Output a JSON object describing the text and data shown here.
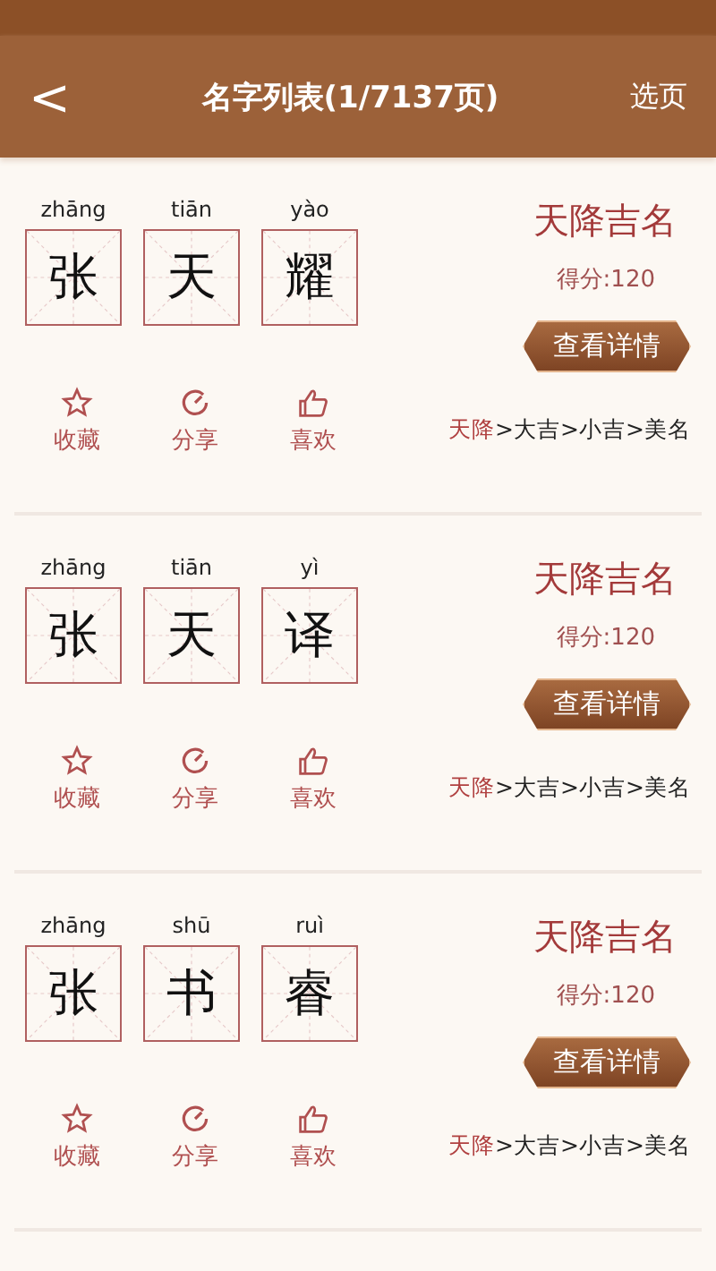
{
  "header": {
    "back": "<",
    "title": "名字列表(1/7137页)",
    "action": "选页"
  },
  "names": [
    {
      "chars": [
        {
          "pinyin": "zhāng",
          "char": "张"
        },
        {
          "pinyin": "tiān",
          "char": "天"
        },
        {
          "pinyin": "yào",
          "char": "耀"
        }
      ],
      "rating": "天降吉名",
      "score": "得分:120",
      "details_button": "查看详情",
      "actions": [
        {
          "kind": "favorite",
          "label": "收藏"
        },
        {
          "kind": "share",
          "label": "分享"
        },
        {
          "kind": "like",
          "label": "喜欢"
        }
      ],
      "separator": ">",
      "levels": [
        {
          "label": "天降",
          "selected": true
        },
        {
          "label": "大吉",
          "selected": false
        },
        {
          "label": "小吉",
          "selected": false
        },
        {
          "label": "美名",
          "selected": false
        }
      ]
    },
    {
      "chars": [
        {
          "pinyin": "zhāng",
          "char": "张"
        },
        {
          "pinyin": "tiān",
          "char": "天"
        },
        {
          "pinyin": "yì",
          "char": "译"
        }
      ],
      "rating": "天降吉名",
      "score": "得分:120",
      "details_button": "查看详情",
      "actions": [
        {
          "kind": "favorite",
          "label": "收藏"
        },
        {
          "kind": "share",
          "label": "分享"
        },
        {
          "kind": "like",
          "label": "喜欢"
        }
      ],
      "separator": ">",
      "levels": [
        {
          "label": "天降",
          "selected": true
        },
        {
          "label": "大吉",
          "selected": false
        },
        {
          "label": "小吉",
          "selected": false
        },
        {
          "label": "美名",
          "selected": false
        }
      ]
    },
    {
      "chars": [
        {
          "pinyin": "zhāng",
          "char": "张"
        },
        {
          "pinyin": "shū",
          "char": "书"
        },
        {
          "pinyin": "ruì",
          "char": "睿"
        }
      ],
      "rating": "天降吉名",
      "score": "得分:120",
      "details_button": "查看详情",
      "actions": [
        {
          "kind": "favorite",
          "label": "收藏"
        },
        {
          "kind": "share",
          "label": "分享"
        },
        {
          "kind": "like",
          "label": "喜欢"
        }
      ],
      "separator": ">",
      "levels": [
        {
          "label": "天降",
          "selected": true
        },
        {
          "label": "大吉",
          "selected": false
        },
        {
          "label": "小吉",
          "selected": false
        },
        {
          "label": "美名",
          "selected": false
        }
      ]
    }
  ]
}
